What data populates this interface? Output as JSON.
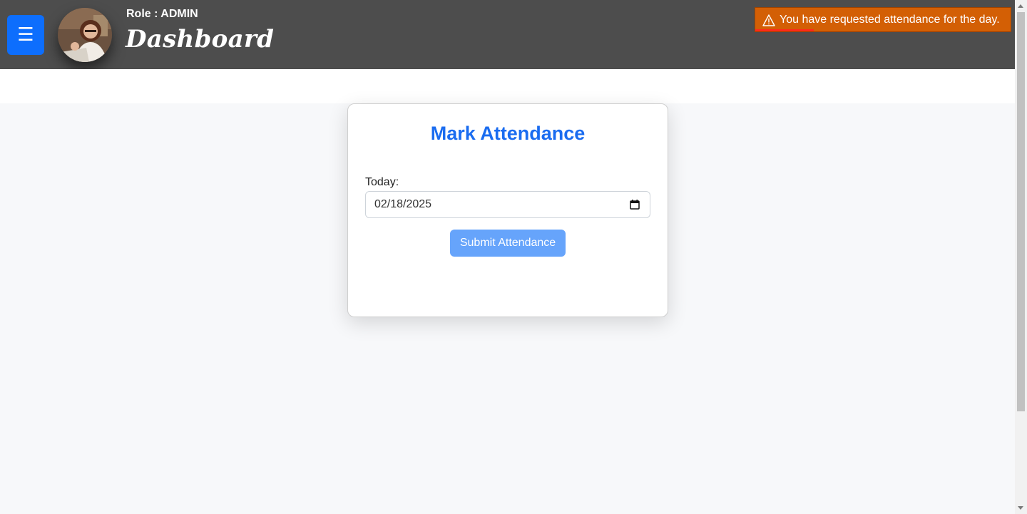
{
  "header": {
    "menu_icon": "☰",
    "avatar_icon": "user-avatar",
    "role_text": "Role : ADMIN",
    "title": "Dashboard"
  },
  "toast": {
    "icon": "warning-icon",
    "message": "You have requested attendance for the day.",
    "progress": 0.23,
    "color": "#d35f05"
  },
  "attendance": {
    "title": "Mark Attendance",
    "date_label": "Today:",
    "date_value": "02/18/2025",
    "calendar_icon": "calendar-icon",
    "submit_label": "Submit Attendance",
    "accent_color": "#1a6cf0"
  }
}
